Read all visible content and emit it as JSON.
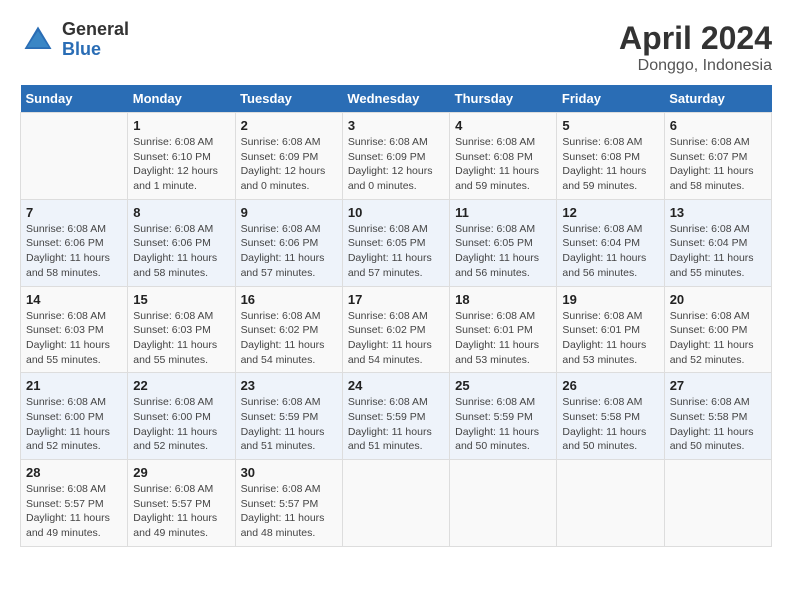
{
  "header": {
    "logo": {
      "general": "General",
      "blue": "Blue"
    },
    "title": "April 2024",
    "subtitle": "Donggo, Indonesia"
  },
  "days_of_week": [
    "Sunday",
    "Monday",
    "Tuesday",
    "Wednesday",
    "Thursday",
    "Friday",
    "Saturday"
  ],
  "weeks": [
    [
      {
        "day": "",
        "info": ""
      },
      {
        "day": "1",
        "info": "Sunrise: 6:08 AM\nSunset: 6:10 PM\nDaylight: 12 hours\nand 1 minute."
      },
      {
        "day": "2",
        "info": "Sunrise: 6:08 AM\nSunset: 6:09 PM\nDaylight: 12 hours\nand 0 minutes."
      },
      {
        "day": "3",
        "info": "Sunrise: 6:08 AM\nSunset: 6:09 PM\nDaylight: 12 hours\nand 0 minutes."
      },
      {
        "day": "4",
        "info": "Sunrise: 6:08 AM\nSunset: 6:08 PM\nDaylight: 11 hours\nand 59 minutes."
      },
      {
        "day": "5",
        "info": "Sunrise: 6:08 AM\nSunset: 6:08 PM\nDaylight: 11 hours\nand 59 minutes."
      },
      {
        "day": "6",
        "info": "Sunrise: 6:08 AM\nSunset: 6:07 PM\nDaylight: 11 hours\nand 58 minutes."
      }
    ],
    [
      {
        "day": "7",
        "info": "Sunrise: 6:08 AM\nSunset: 6:06 PM\nDaylight: 11 hours\nand 58 minutes."
      },
      {
        "day": "8",
        "info": "Sunrise: 6:08 AM\nSunset: 6:06 PM\nDaylight: 11 hours\nand 58 minutes."
      },
      {
        "day": "9",
        "info": "Sunrise: 6:08 AM\nSunset: 6:06 PM\nDaylight: 11 hours\nand 57 minutes."
      },
      {
        "day": "10",
        "info": "Sunrise: 6:08 AM\nSunset: 6:05 PM\nDaylight: 11 hours\nand 57 minutes."
      },
      {
        "day": "11",
        "info": "Sunrise: 6:08 AM\nSunset: 6:05 PM\nDaylight: 11 hours\nand 56 minutes."
      },
      {
        "day": "12",
        "info": "Sunrise: 6:08 AM\nSunset: 6:04 PM\nDaylight: 11 hours\nand 56 minutes."
      },
      {
        "day": "13",
        "info": "Sunrise: 6:08 AM\nSunset: 6:04 PM\nDaylight: 11 hours\nand 55 minutes."
      }
    ],
    [
      {
        "day": "14",
        "info": "Sunrise: 6:08 AM\nSunset: 6:03 PM\nDaylight: 11 hours\nand 55 minutes."
      },
      {
        "day": "15",
        "info": "Sunrise: 6:08 AM\nSunset: 6:03 PM\nDaylight: 11 hours\nand 55 minutes."
      },
      {
        "day": "16",
        "info": "Sunrise: 6:08 AM\nSunset: 6:02 PM\nDaylight: 11 hours\nand 54 minutes."
      },
      {
        "day": "17",
        "info": "Sunrise: 6:08 AM\nSunset: 6:02 PM\nDaylight: 11 hours\nand 54 minutes."
      },
      {
        "day": "18",
        "info": "Sunrise: 6:08 AM\nSunset: 6:01 PM\nDaylight: 11 hours\nand 53 minutes."
      },
      {
        "day": "19",
        "info": "Sunrise: 6:08 AM\nSunset: 6:01 PM\nDaylight: 11 hours\nand 53 minutes."
      },
      {
        "day": "20",
        "info": "Sunrise: 6:08 AM\nSunset: 6:00 PM\nDaylight: 11 hours\nand 52 minutes."
      }
    ],
    [
      {
        "day": "21",
        "info": "Sunrise: 6:08 AM\nSunset: 6:00 PM\nDaylight: 11 hours\nand 52 minutes."
      },
      {
        "day": "22",
        "info": "Sunrise: 6:08 AM\nSunset: 6:00 PM\nDaylight: 11 hours\nand 52 minutes."
      },
      {
        "day": "23",
        "info": "Sunrise: 6:08 AM\nSunset: 5:59 PM\nDaylight: 11 hours\nand 51 minutes."
      },
      {
        "day": "24",
        "info": "Sunrise: 6:08 AM\nSunset: 5:59 PM\nDaylight: 11 hours\nand 51 minutes."
      },
      {
        "day": "25",
        "info": "Sunrise: 6:08 AM\nSunset: 5:59 PM\nDaylight: 11 hours\nand 50 minutes."
      },
      {
        "day": "26",
        "info": "Sunrise: 6:08 AM\nSunset: 5:58 PM\nDaylight: 11 hours\nand 50 minutes."
      },
      {
        "day": "27",
        "info": "Sunrise: 6:08 AM\nSunset: 5:58 PM\nDaylight: 11 hours\nand 50 minutes."
      }
    ],
    [
      {
        "day": "28",
        "info": "Sunrise: 6:08 AM\nSunset: 5:57 PM\nDaylight: 11 hours\nand 49 minutes."
      },
      {
        "day": "29",
        "info": "Sunrise: 6:08 AM\nSunset: 5:57 PM\nDaylight: 11 hours\nand 49 minutes."
      },
      {
        "day": "30",
        "info": "Sunrise: 6:08 AM\nSunset: 5:57 PM\nDaylight: 11 hours\nand 48 minutes."
      },
      {
        "day": "",
        "info": ""
      },
      {
        "day": "",
        "info": ""
      },
      {
        "day": "",
        "info": ""
      },
      {
        "day": "",
        "info": ""
      }
    ]
  ]
}
